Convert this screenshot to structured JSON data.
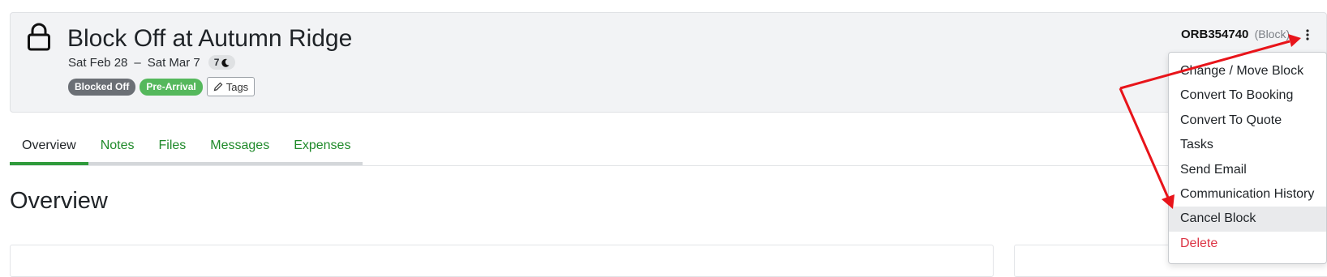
{
  "header": {
    "title": "Block Off at Autumn Ridge",
    "date_start": "Sat Feb 28",
    "date_sep": "–",
    "date_end": "Sat Mar 7",
    "nights": "7",
    "badges": [
      {
        "label": "Blocked Off",
        "color": "#6b6f75"
      },
      {
        "label": "Pre-Arrival",
        "color": "#55b85c"
      }
    ],
    "tags_label": "Tags",
    "reference": "ORB354740",
    "reference_type": "(Block)"
  },
  "tabs": [
    {
      "label": "Overview",
      "active": true
    },
    {
      "label": "Notes",
      "active": false
    },
    {
      "label": "Files",
      "active": false
    },
    {
      "label": "Messages",
      "active": false
    },
    {
      "label": "Expenses",
      "active": false
    }
  ],
  "section": {
    "title": "Overview"
  },
  "menu": {
    "items": [
      {
        "label": "Change / Move Block"
      },
      {
        "label": "Convert To Booking"
      },
      {
        "label": "Convert To Quote"
      },
      {
        "label": "Tasks"
      },
      {
        "label": "Send Email"
      },
      {
        "label": "Communication History"
      },
      {
        "label": "Cancel Block",
        "hover": true
      },
      {
        "label": "Delete",
        "danger": true
      }
    ]
  },
  "colors": {
    "accent_green": "#2f9a3b",
    "link_green": "#1f8a2a",
    "danger": "#dc3545",
    "annotation_arrow": "#e8141a"
  },
  "icons": {
    "lock": "lock-icon",
    "moon": "moon-icon",
    "pencil": "pencil-icon",
    "kebab": "kebab-menu-icon"
  }
}
